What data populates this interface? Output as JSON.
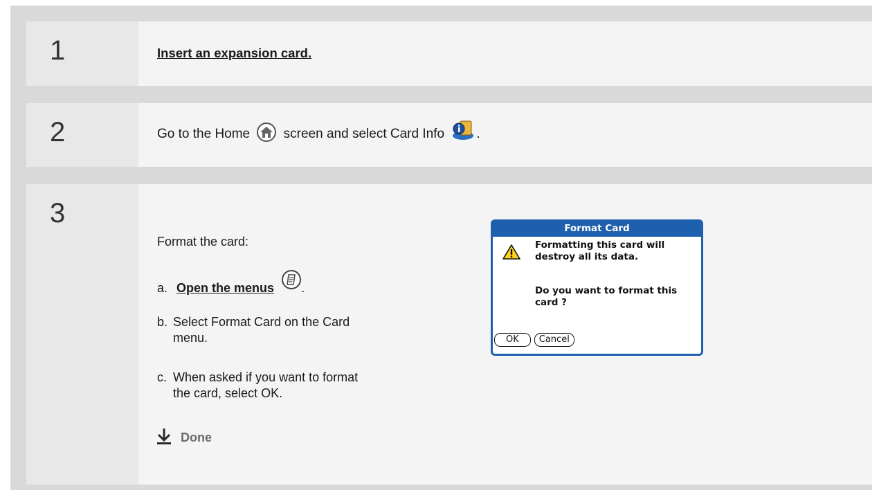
{
  "steps": [
    {
      "number": "1",
      "link_text": "Insert an expansion card",
      "suffix": "."
    },
    {
      "number": "2",
      "text_before": "Go to the Home ",
      "text_middle": " screen and select Card Info ",
      "text_after": "."
    },
    {
      "number": "3",
      "intro": "Format the card:",
      "items": [
        {
          "label": "a.",
          "link_text": "Open the menus",
          "suffix": "."
        },
        {
          "label": "b.",
          "text": "Select Format Card on the Card menu."
        },
        {
          "label": "c.",
          "text": "When asked if you want to format the card, select OK."
        }
      ],
      "done_label": "Done"
    }
  ],
  "dialog": {
    "title": "Format Card",
    "message": "Formatting this card will destroy all its data.",
    "question": "Do you want to format this card ?",
    "ok_label": "OK",
    "cancel_label": "Cancel"
  },
  "icons": {
    "home": "home-icon",
    "card_info": "card-info-icon",
    "menu": "menu-icon",
    "warning": "warning-icon",
    "done_arrow": "down-arrow-icon"
  },
  "colors": {
    "dialog_accent": "#1e5fae",
    "done_text": "#6b6b6b"
  }
}
